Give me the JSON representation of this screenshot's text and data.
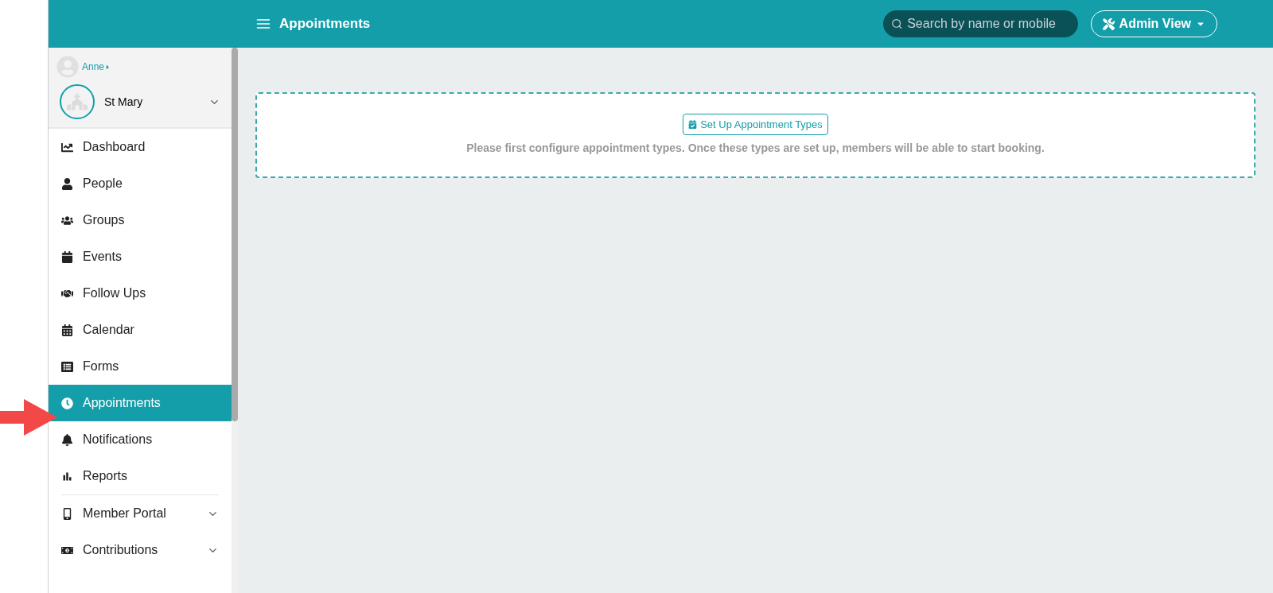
{
  "header": {
    "title": "Appointments",
    "search": {
      "placeholder": "Search by name or mobile"
    },
    "view_button": "Admin View"
  },
  "sidebar": {
    "user": "Anne",
    "organization": "St Mary",
    "items": [
      {
        "label": "Dashboard",
        "selected": false,
        "kind": "link"
      },
      {
        "label": "People",
        "selected": false,
        "kind": "link"
      },
      {
        "label": "Groups",
        "selected": false,
        "kind": "link"
      },
      {
        "label": "Events",
        "selected": false,
        "kind": "link"
      },
      {
        "label": "Follow Ups",
        "selected": false,
        "kind": "link"
      },
      {
        "label": "Calendar",
        "selected": false,
        "kind": "link"
      },
      {
        "label": "Forms",
        "selected": false,
        "kind": "link"
      },
      {
        "label": "Appointments",
        "selected": true,
        "kind": "link"
      },
      {
        "label": "Notifications",
        "selected": false,
        "kind": "link"
      },
      {
        "label": "Reports",
        "selected": false,
        "kind": "link"
      },
      {
        "label": "Member Portal",
        "selected": false,
        "kind": "submenu",
        "expanded": false
      },
      {
        "label": "Contributions",
        "selected": false,
        "kind": "submenu",
        "expanded": false
      }
    ]
  },
  "empty_state": {
    "button": "Set Up Appointment Types",
    "message": "Please first configure appointment types. Once these types are set up, members will be able to start booking."
  }
}
